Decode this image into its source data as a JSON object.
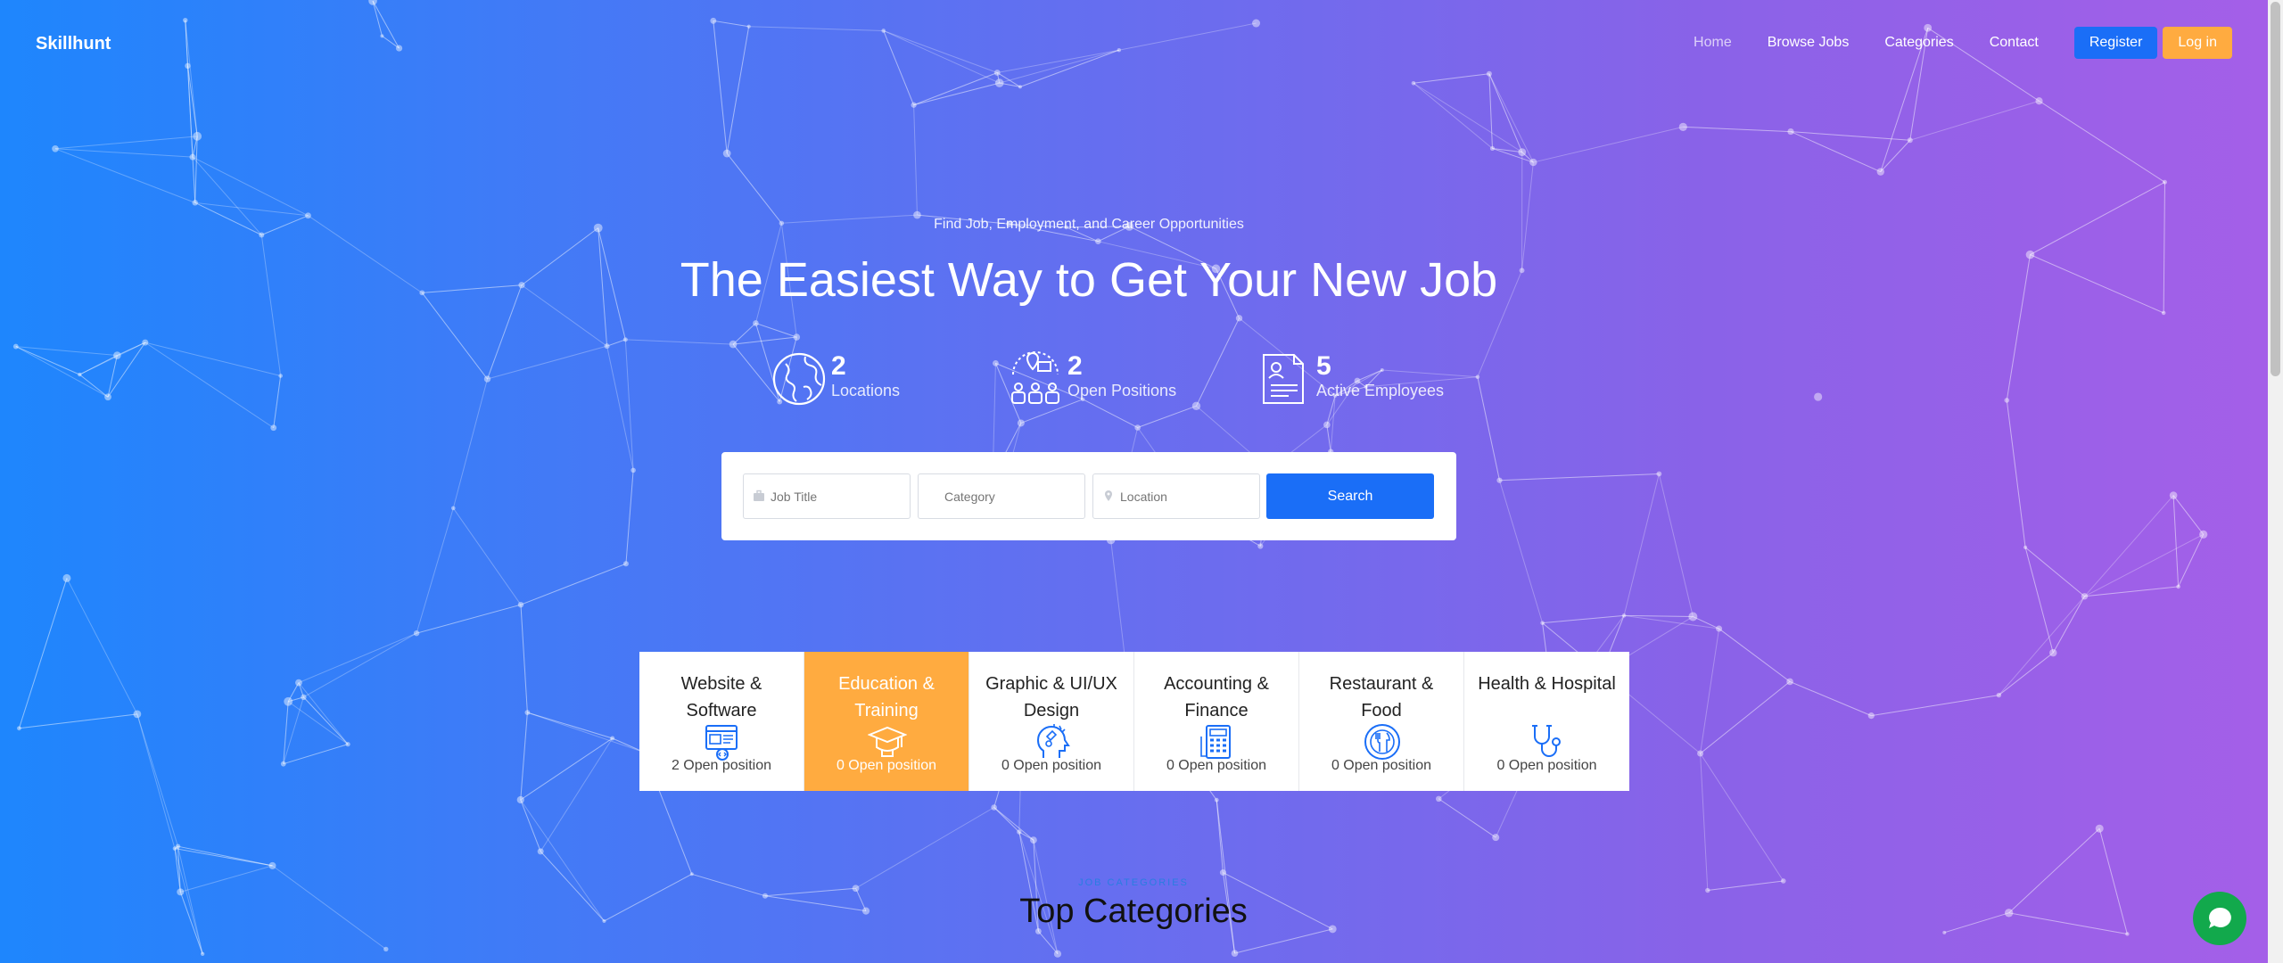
{
  "brand": "Skillhunt",
  "nav": {
    "home": "Home",
    "browse_jobs": "Browse Jobs",
    "categories": "Categories",
    "contact": "Contact",
    "register": "Register",
    "login": "Log in"
  },
  "hero": {
    "subtitle": "Find Job, Employment, and Career Opportunities",
    "headline": "The Easiest Way to Get Your New Job"
  },
  "stats": [
    {
      "icon": "globe-icon",
      "value": "2",
      "label": "Locations"
    },
    {
      "icon": "team-location-icon",
      "value": "2",
      "label": "Open Positions"
    },
    {
      "icon": "resume-icon",
      "value": "5",
      "label": "Active Employees"
    }
  ],
  "search": {
    "job_title_placeholder": "Job Title",
    "category_placeholder": "Category",
    "location_placeholder": "Location",
    "button": "Search"
  },
  "categories": [
    {
      "name": "Website & Software",
      "positions": "2 Open position",
      "icon": "website-icon"
    },
    {
      "name": "Education & Training",
      "positions": "0 Open position",
      "icon": "graduation-cap-icon"
    },
    {
      "name": "Graphic & UI/UX Design",
      "positions": "0 Open position",
      "icon": "creative-mind-icon"
    },
    {
      "name": "Accounting & Finance",
      "positions": "0 Open position",
      "icon": "calculator-icon"
    },
    {
      "name": "Restaurant & Food",
      "positions": "0 Open position",
      "icon": "dining-plate-icon"
    },
    {
      "name": "Health & Hospital",
      "positions": "0 Open position",
      "icon": "stethoscope-icon"
    }
  ],
  "section": {
    "eyebrow": "JOB CATEGORIES",
    "title": "Top Categories"
  },
  "colors": {
    "primary": "#1a6ef7",
    "accent": "#ffab40",
    "gradient_start": "#1e86fd",
    "gradient_end": "#a55fe8",
    "chat": "#12a94c"
  }
}
